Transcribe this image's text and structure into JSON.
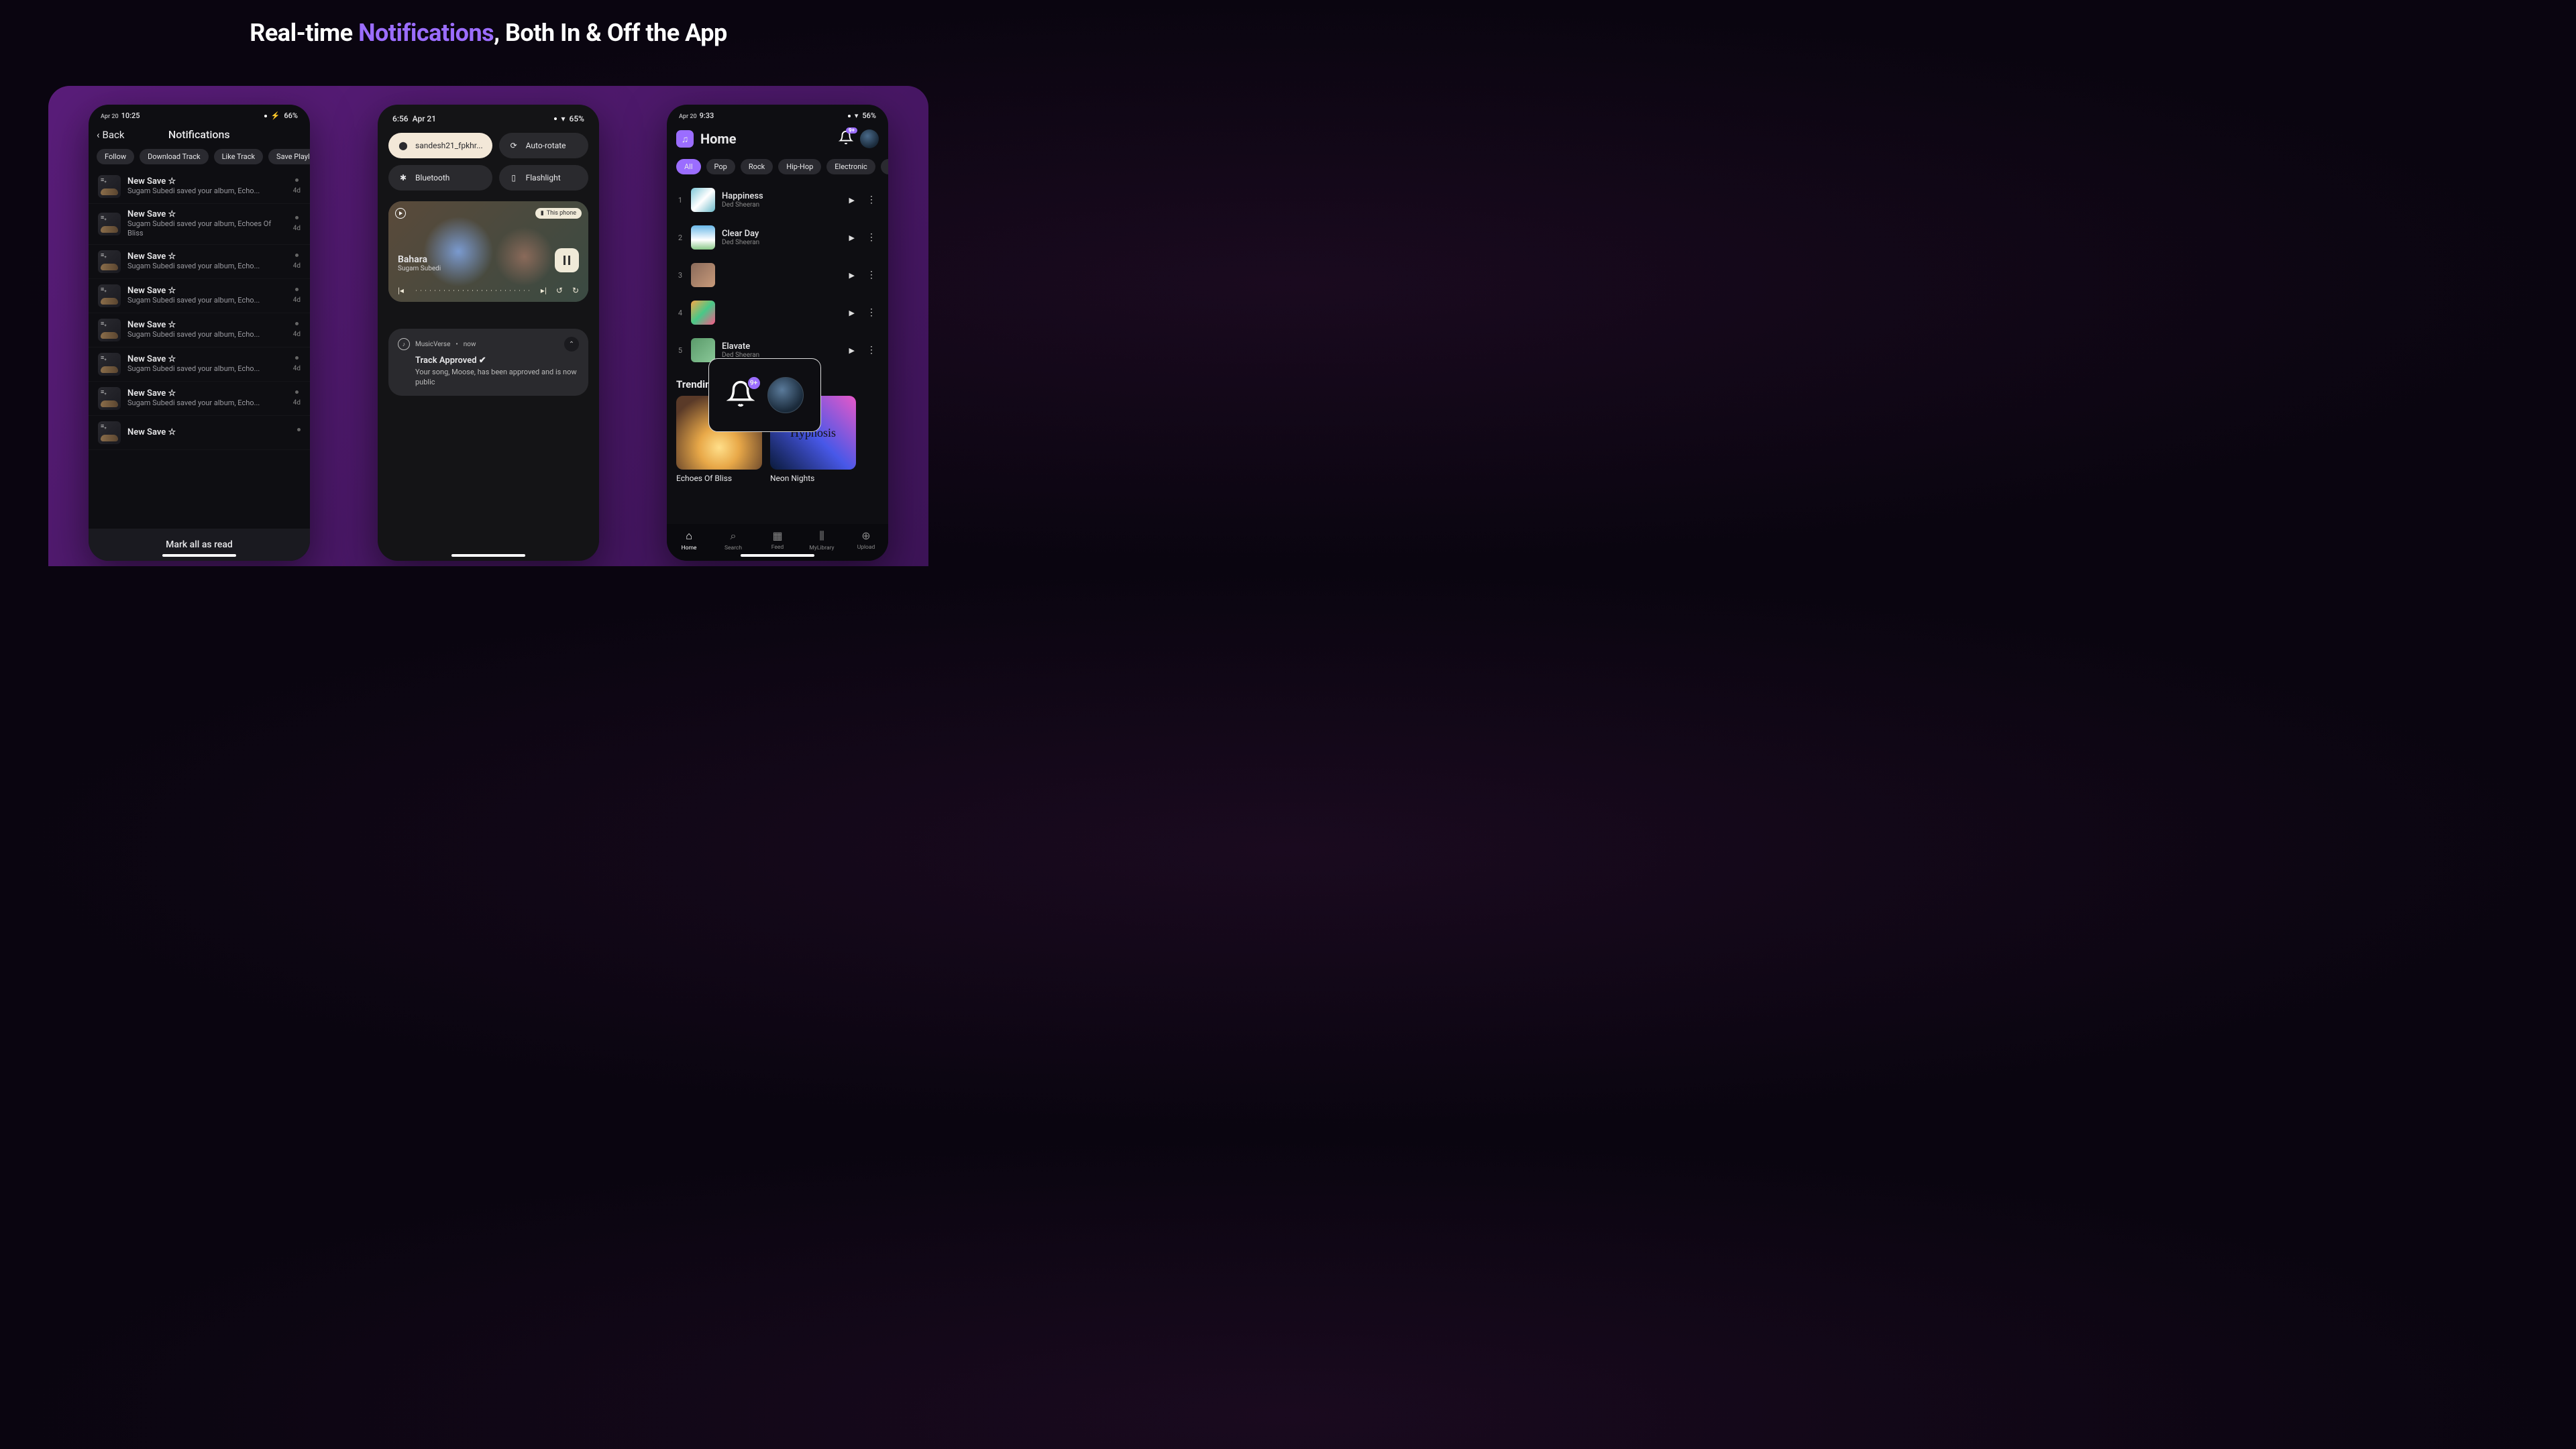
{
  "headline": {
    "pre": "Real-time ",
    "accent": "Notifications",
    "post": ", Both In & Off the App"
  },
  "phone1": {
    "status": {
      "date": "Apr 20",
      "time": "10:25",
      "battery": "66%"
    },
    "back_label": "Back",
    "title": "Notifications",
    "filters": [
      "Follow",
      "Download Track",
      "Like Track",
      "Save Playlist"
    ],
    "items": [
      {
        "title": "New Save ☆",
        "sub": "Sugam Subedi saved your album, Echo...",
        "time": "4d"
      },
      {
        "title": "New Save ☆",
        "sub": "Sugam Subedi saved your album, Echoes Of Bliss",
        "time": "4d"
      },
      {
        "title": "New Save ☆",
        "sub": "Sugam Subedi saved your album, Echo...",
        "time": "4d"
      },
      {
        "title": "New Save ☆",
        "sub": "Sugam Subedi saved your album, Echo...",
        "time": "4d"
      },
      {
        "title": "New Save ☆",
        "sub": "Sugam Subedi saved your album, Echo...",
        "time": "4d"
      },
      {
        "title": "New Save ☆",
        "sub": "Sugam Subedi saved your album, Echo...",
        "time": "4d"
      },
      {
        "title": "New Save ☆",
        "sub": "Sugam Subedi saved your album, Echo...",
        "time": "4d"
      },
      {
        "title": "New Save ☆",
        "sub": "",
        "time": ""
      }
    ],
    "mark_all": "Mark all as read"
  },
  "phone2": {
    "status": {
      "time": "6:56",
      "date": "Apr 21",
      "battery": "65%"
    },
    "tiles": {
      "wifi": "sandesh21_fpkhr...",
      "autorotate": "Auto-rotate",
      "bluetooth": "Bluetooth",
      "flashlight": "Flashlight"
    },
    "media": {
      "device_chip": "This phone",
      "title": "Bahara",
      "artist": "Sugam Subedi"
    },
    "notif": {
      "app": "MusicVerse",
      "when": "now",
      "title": "Track Approved ✔",
      "message": "Your song, Moose, has been approved and is now public"
    }
  },
  "phone3": {
    "status": {
      "date": "Apr 20",
      "time": "9:33",
      "battery": "56%"
    },
    "title": "Home",
    "badge": "9+",
    "genres": [
      "All",
      "Pop",
      "Rock",
      "Hip-Hop",
      "Electronic",
      "R&"
    ],
    "tracks": [
      {
        "n": "1",
        "title": "Happiness",
        "artist": "Ded Sheeran",
        "art": "linear-gradient(135deg,#7ec8d8 0%,#fff 50%,#6ab8c8 100%)"
      },
      {
        "n": "2",
        "title": "Clear Day",
        "artist": "Ded Sheeran",
        "art": "linear-gradient(180deg,#6ab8e8 0%,#fff 60%,#8ac888 100%)"
      },
      {
        "n": "3",
        "title": "",
        "artist": "",
        "art": "linear-gradient(135deg,#8a6a5a 0%,#c89a7a 100%)"
      },
      {
        "n": "4",
        "title": "",
        "artist": "",
        "art": "linear-gradient(135deg,#f8a848 0%,#48c888 50%,#f85888 100%)"
      },
      {
        "n": "5",
        "title": "Elavate",
        "artist": "Ded Sheeran",
        "art": "linear-gradient(135deg,#5a9a6a 0%,#8ac898 100%)"
      }
    ],
    "trending_label": "Trending Albums",
    "albums": [
      {
        "title": "Echoes Of Bliss",
        "art": "radial-gradient(circle at 50% 70%,#ffdf8a 0%,#e8a848 30%,#5a3a28 80%)"
      },
      {
        "title": "Neon Nights",
        "art": "linear-gradient(225deg,#e858c8 0%,#4858e8 50%,#0a1a3a 100%)"
      }
    ],
    "album2_overlay": "Hypnosis",
    "tabs": [
      {
        "label": "Home",
        "icon": "⌂"
      },
      {
        "label": "Search",
        "icon": "⌕"
      },
      {
        "label": "Feed",
        "icon": "▦"
      },
      {
        "label": "MyLibrary",
        "icon": "⫼"
      },
      {
        "label": "Upload",
        "icon": "⊕"
      }
    ],
    "callout_badge": "9+"
  }
}
